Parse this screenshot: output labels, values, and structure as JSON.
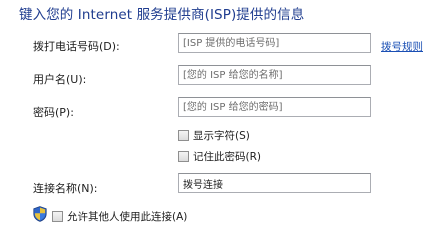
{
  "heading": "键入您的 Internet 服务提供商(ISP)提供的信息",
  "form": {
    "dial": {
      "label": "拨打电话号码(D):",
      "placeholder": "[ISP 提供的电话号码]",
      "value": ""
    },
    "dial_rules_link": "拨号规则",
    "username": {
      "label": "用户名(U):",
      "placeholder": "[您的 ISP 给您的名称]",
      "value": ""
    },
    "password": {
      "label": "密码(P):",
      "placeholder": "[您的 ISP 给您的密码]",
      "value": ""
    },
    "show_chars": {
      "label": "显示字符(S)",
      "checked": false
    },
    "remember_password": {
      "label": "记住此密码(R)",
      "checked": false
    },
    "connection_name": {
      "label": "连接名称(N):",
      "value": "拨号连接"
    },
    "allow_others": {
      "label": "允许其他人使用此连接(A)",
      "checked": false
    }
  },
  "icons": {
    "uac_shield": "shield-icon"
  },
  "colors": {
    "heading": "#1f3c8f",
    "link": "#1a4fb4",
    "field_border": "#abadb3",
    "placeholder": "#6d6d6d"
  }
}
